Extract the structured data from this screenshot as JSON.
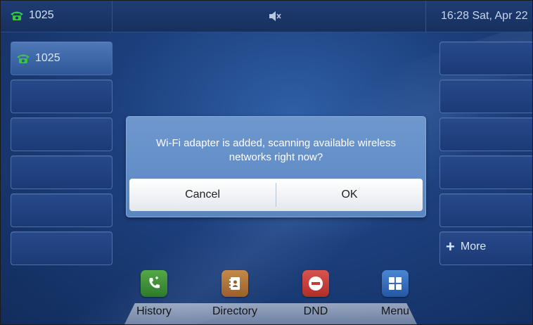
{
  "topbar": {
    "account": "1025",
    "datetime": "16:28 Sat, Apr 22"
  },
  "line_keys": {
    "key1_label": "1025",
    "more_label": "More"
  },
  "dialog": {
    "message": "Wi-Fi adapter is added, scanning available wireless networks right now?",
    "cancel_label": "Cancel",
    "ok_label": "OK"
  },
  "dock": {
    "history": "History",
    "directory": "Directory",
    "dnd": "DND",
    "menu": "Menu"
  },
  "colors": {
    "history": "#3a8a3c",
    "directory": "#a9743d",
    "dnd": "#c73a36",
    "menu": "#2f66b6"
  }
}
